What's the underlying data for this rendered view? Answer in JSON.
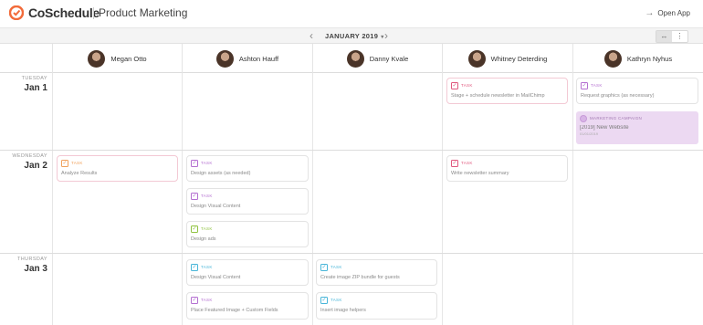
{
  "app": {
    "brand": "CoSchedule",
    "workspace": "Product Marketing",
    "open_app": "Open App"
  },
  "month": {
    "label": "JANUARY 2019"
  },
  "people": [
    {
      "name": "Megan Otto"
    },
    {
      "name": "Ashton Hauff"
    },
    {
      "name": "Danny Kvale"
    },
    {
      "name": "Whitney Deterding"
    },
    {
      "name": "Kathryn Nyhus"
    }
  ],
  "days": [
    {
      "weekday": "TUESDAY",
      "date": "Jan 1"
    },
    {
      "weekday": "WEDNESDAY",
      "date": "Jan 2"
    },
    {
      "weekday": "THURSDAY",
      "date": "Jan 3"
    }
  ],
  "colors": {
    "pink": "#e0577d",
    "purple": "#b46fd1",
    "green": "#8fc23f",
    "teal": "#49b6d9",
    "orange": "#f0a05a"
  },
  "cards": [
    {
      "type": "TASK",
      "title": "Stage + schedule newsletter in MailChimp",
      "color": "#e0577d"
    },
    {
      "type": "TASK",
      "title": "Request graphics (as necessary)",
      "color": "#b46fd1"
    },
    {
      "type": "TASK",
      "title": "Analyze Results",
      "color": "#f0a05a"
    },
    {
      "type": "TASK",
      "title": "Design assets (as needed)",
      "color": "#b46fd1"
    },
    {
      "type": "TASK",
      "title": "Design Visual Content",
      "color": "#b46fd1"
    },
    {
      "type": "TASK",
      "title": "Design ads",
      "color": "#8fc23f"
    },
    {
      "type": "TASK",
      "title": "Write newsletter summary",
      "color": "#e0577d"
    },
    {
      "type": "TASK",
      "title": "Design Visual Content",
      "color": "#49b6d9"
    },
    {
      "type": "TASK",
      "title": "Place Featured Image + Custom Fields",
      "color": "#b46fd1"
    },
    {
      "type": "TASK",
      "title": "Create image ZIP bundle for guests",
      "color": "#49b6d9"
    },
    {
      "type": "TASK",
      "title": "Insert image helpers",
      "color": "#49b6d9"
    }
  ],
  "campaign": {
    "type": "MARKETING CAMPAIGN",
    "title": "[2019] New Website",
    "date": "01/01/2019"
  }
}
